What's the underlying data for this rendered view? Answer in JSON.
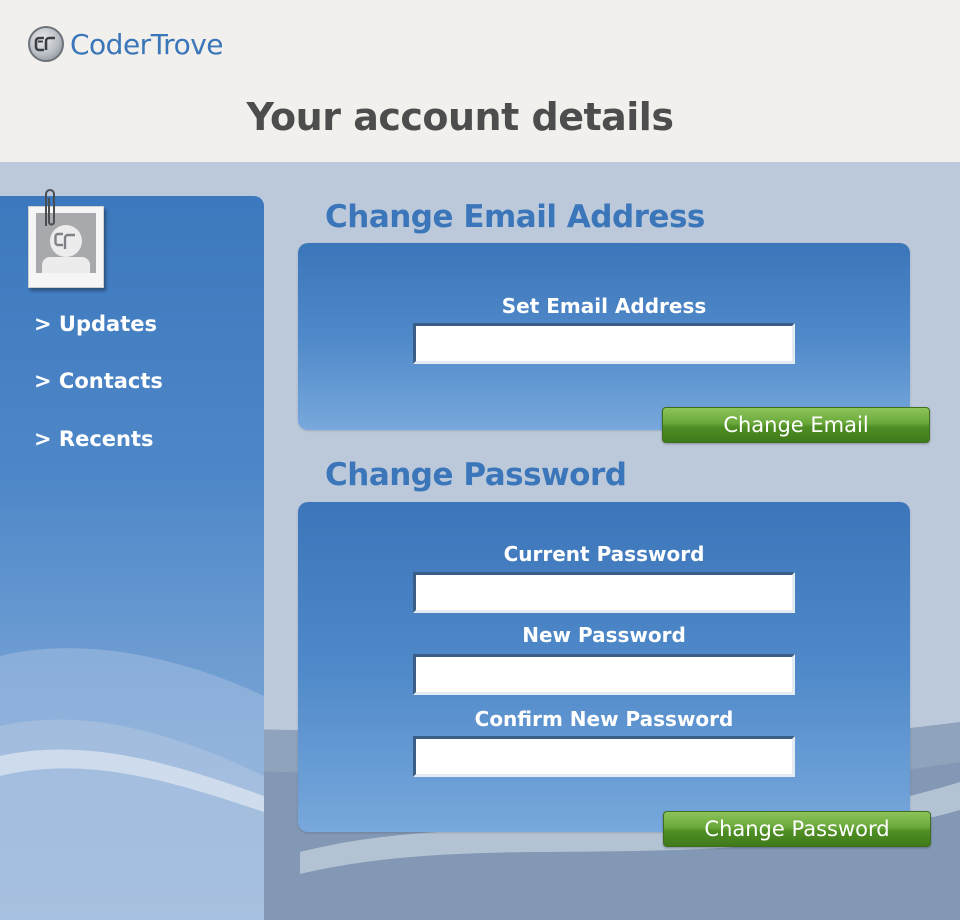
{
  "header": {
    "brand_name": "CoderTrove",
    "logo_icon": "codertrove-logo-icon",
    "page_title": "Your account details"
  },
  "sidebar": {
    "avatar_icon": "user-avatar-icon",
    "items": [
      {
        "label": "> Updates"
      },
      {
        "label": "> Contacts"
      },
      {
        "label": "> Recents"
      }
    ]
  },
  "email_section": {
    "title": "Change Email Address",
    "field_label": "Set Email Address",
    "email_value": "",
    "button_label": "Change Email"
  },
  "password_section": {
    "title": "Change Password",
    "current_label": "Current Password",
    "current_value": "",
    "new_label": "New Password",
    "new_value": "",
    "confirm_label": "Confirm New Password",
    "confirm_value": "",
    "button_label": "Change Password"
  },
  "colors": {
    "accent_blue": "#3a76b9",
    "header_bg": "#f2f0ec",
    "button_green": "#5a9a2e"
  }
}
